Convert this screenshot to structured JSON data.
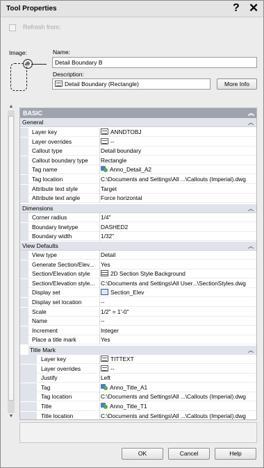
{
  "window": {
    "title": "Tool Properties"
  },
  "titlebar": {
    "help": "?",
    "close": "✕"
  },
  "refresh": {
    "label": "Refresh from:"
  },
  "image": {
    "label": "Image:"
  },
  "name": {
    "label": "Name:",
    "value": "Detail Boundary B"
  },
  "description": {
    "label": "Description:",
    "value": "Detail Boundary (Rectangle)",
    "more_info": "More Info"
  },
  "grid": {
    "section": "BASIC",
    "categories": {
      "general": "General",
      "dimensions": "Dimensions",
      "view_defaults": "View Defaults",
      "title_mark": "Title Mark"
    },
    "general": [
      {
        "name": "Layer key",
        "value": "ANNDTOBJ",
        "icon": "layer-list"
      },
      {
        "name": "Layer overrides",
        "value": "--",
        "icon": "layer-list"
      },
      {
        "name": "Callout type",
        "value": "Detail boundary"
      },
      {
        "name": "Callout boundary type",
        "value": "Rectangle"
      },
      {
        "name": "Tag name",
        "value": "Anno_Detail_A2",
        "icon": "tag"
      },
      {
        "name": "Tag location",
        "value": "C:\\Documents and Settings\\All ...\\Callouts (Imperial).dwg"
      },
      {
        "name": "Attribute text style",
        "value": "Target"
      },
      {
        "name": "Attribute text angle",
        "value": "Force horizontal"
      }
    ],
    "dimensions": [
      {
        "name": "Corner radius",
        "value": "1/4\""
      },
      {
        "name": "Boundary linetype",
        "value": "DASHED2"
      },
      {
        "name": "Boundary width",
        "value": "1/32\""
      }
    ],
    "view_defaults": [
      {
        "name": "View type",
        "value": "Detail"
      },
      {
        "name": "Generate Section/Elev...",
        "value": "Yes"
      },
      {
        "name": "Section/Elevation style",
        "value": "2D Section Style Background",
        "icon": "style-grid"
      },
      {
        "name": "Section/Elevation style...",
        "value": "C:\\Documents and Settings\\All User...\\SectionStyles.dwg"
      },
      {
        "name": "Display set",
        "value": "Section_Elev",
        "icon": "display-set"
      },
      {
        "name": "Display set location",
        "value": "--"
      },
      {
        "name": "Scale",
        "value": "1/2\" = 1'-0\""
      },
      {
        "name": "Name",
        "value": "--"
      },
      {
        "name": "Increment",
        "value": "Integer"
      },
      {
        "name": "Place a title mark",
        "value": "Yes"
      }
    ],
    "title_mark": [
      {
        "name": "Layer key",
        "value": "TITTEXT",
        "icon": "layer-list"
      },
      {
        "name": "Layer overrides",
        "value": "--",
        "icon": "layer-list"
      },
      {
        "name": "Justify",
        "value": "Left"
      },
      {
        "name": "Tag",
        "value": "Anno_Title_A1",
        "icon": "tag"
      },
      {
        "name": "Tag location",
        "value": "C:\\Documents and Settings\\All ...\\Callouts (Imperial).dwg"
      },
      {
        "name": "Title",
        "value": "Anno_Title_T1",
        "icon": "tag"
      },
      {
        "name": "Title location",
        "value": "C:\\Documents and Settings\\All ...\\Callouts (Imperial).dwg"
      }
    ]
  },
  "footer": {
    "ok": "OK",
    "cancel": "Cancel",
    "help": "Help"
  }
}
